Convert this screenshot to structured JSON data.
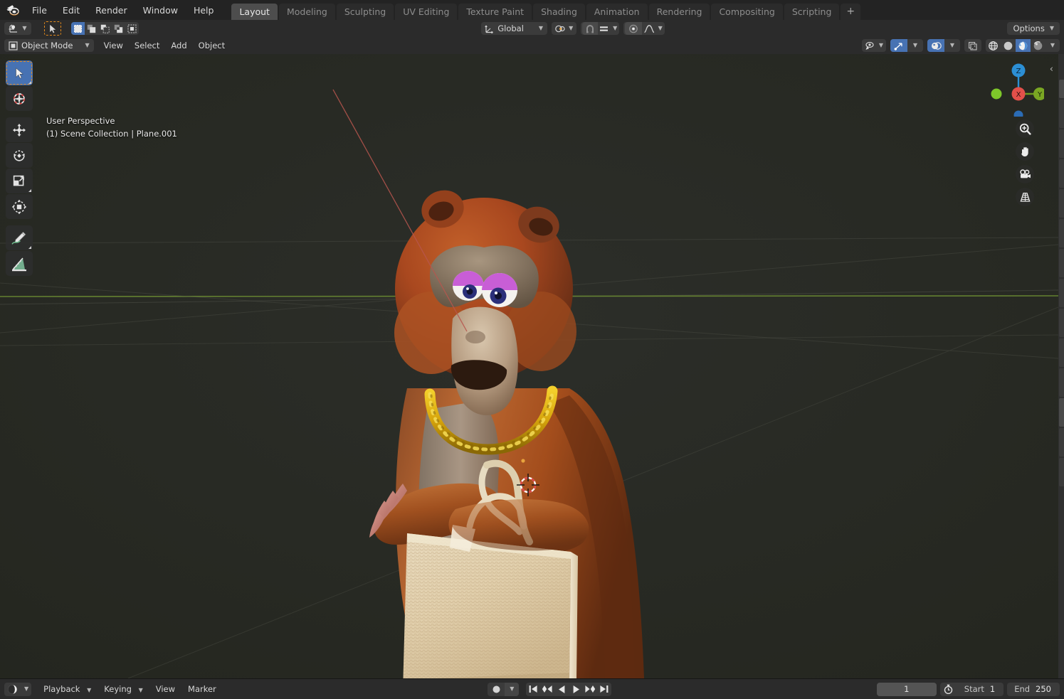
{
  "app": {
    "name": "Blender",
    "logo_icon": "blender-logo-icon"
  },
  "topbar": {
    "menus": [
      {
        "label": "File",
        "name": "menu-file"
      },
      {
        "label": "Edit",
        "name": "menu-edit"
      },
      {
        "label": "Render",
        "name": "menu-render"
      },
      {
        "label": "Window",
        "name": "menu-window"
      },
      {
        "label": "Help",
        "name": "menu-help"
      }
    ],
    "workspace_tabs": [
      {
        "label": "Layout",
        "active": true
      },
      {
        "label": "Modeling",
        "active": false
      },
      {
        "label": "Sculpting",
        "active": false
      },
      {
        "label": "UV Editing",
        "active": false
      },
      {
        "label": "Texture Paint",
        "active": false
      },
      {
        "label": "Shading",
        "active": false
      },
      {
        "label": "Animation",
        "active": false
      },
      {
        "label": "Rendering",
        "active": false
      },
      {
        "label": "Compositing",
        "active": false
      },
      {
        "label": "Scripting",
        "active": false
      }
    ],
    "add_workspace_label": "+"
  },
  "tool_header": {
    "editor_type_icon": "editor-type-3dview-icon",
    "active_tool_icon": "tweak-cursor-icon",
    "select_modes": [
      {
        "name": "select-set-mode",
        "active": true
      },
      {
        "name": "select-extend-mode",
        "active": false
      },
      {
        "name": "select-subtract-mode",
        "active": false
      },
      {
        "name": "select-invert-mode",
        "active": false
      },
      {
        "name": "select-intersect-mode",
        "active": false
      }
    ],
    "transform_orientation": {
      "label": "Global",
      "icon": "orientation-global-icon"
    },
    "pivot_point": {
      "icon": "pivot-median-point-icon"
    },
    "snap": {
      "magnet_icon": "magnet-icon",
      "snap_to_icon": "snap-increment-icon",
      "enabled": false
    },
    "proportional_editing": {
      "toggle_icon": "proportional-edit-icon",
      "falloff_icon": "falloff-smooth-icon",
      "enabled": false
    },
    "options_label": "Options"
  },
  "viewport_header": {
    "mode": {
      "label": "Object Mode",
      "icon": "object-mode-icon"
    },
    "menus": [
      {
        "label": "View",
        "name": "viewport-menu-view"
      },
      {
        "label": "Select",
        "name": "viewport-menu-select"
      },
      {
        "label": "Add",
        "name": "viewport-menu-add"
      },
      {
        "label": "Object",
        "name": "viewport-menu-object"
      }
    ],
    "right_controls": [
      {
        "name": "visibility-selector",
        "icon": "eye-cursor-icon",
        "active": false
      },
      {
        "name": "gizmo-toggle",
        "icon": "gizmo-icon",
        "active": true
      },
      {
        "name": "overlays-toggle",
        "icon": "overlays-icon",
        "active": true
      },
      {
        "name": "xray-toggle",
        "icon": "xray-icon",
        "active": false
      }
    ],
    "shading_modes": [
      {
        "name": "shading-wireframe",
        "icon": "wireframe-globe-icon",
        "active": false
      },
      {
        "name": "shading-solid",
        "icon": "solid-sphere-icon",
        "active": false
      },
      {
        "name": "shading-material-preview",
        "icon": "material-preview-icon",
        "active": true
      },
      {
        "name": "shading-rendered",
        "icon": "rendered-sphere-icon",
        "active": false
      }
    ]
  },
  "viewport": {
    "overlay_line_1": "User Perspective",
    "overlay_line_2": "(1) Scene Collection | Plane.001",
    "background_color": "#282a26",
    "grid_color": "#3a3c38",
    "y_axis_color": "#6a8a32",
    "left_toolbar": [
      {
        "name": "tool-tweak",
        "icon": "cursor-arrow-icon",
        "selected": true,
        "has_submenu": true
      },
      {
        "name": "tool-cursor",
        "icon": "3d-cursor-icon",
        "selected": false,
        "has_submenu": false
      },
      {
        "name": "tool-move",
        "icon": "move-arrows-icon",
        "selected": false,
        "has_submenu": false,
        "group_start": true
      },
      {
        "name": "tool-rotate",
        "icon": "rotate-icon",
        "selected": false,
        "has_submenu": false
      },
      {
        "name": "tool-scale",
        "icon": "scale-icon",
        "selected": false,
        "has_submenu": true
      },
      {
        "name": "tool-transform",
        "icon": "transform-icon",
        "selected": false,
        "has_submenu": false
      },
      {
        "name": "tool-annotate",
        "icon": "pencil-annotate-icon",
        "selected": false,
        "has_submenu": true,
        "group_start": true
      },
      {
        "name": "tool-measure",
        "icon": "ruler-measure-icon",
        "selected": false,
        "has_submenu": false
      }
    ],
    "nav_gizmo": {
      "axes": [
        {
          "label": "X",
          "color": "#e2504a",
          "name": "gizmo-axis-x"
        },
        {
          "label": "Y",
          "color": "#7aa723",
          "name": "gizmo-axis-y"
        },
        {
          "label": "Z",
          "color": "#2c8fd4",
          "name": "gizmo-axis-z"
        }
      ],
      "negative_axis_colors": [
        "#7ec82a",
        "#2b6cb5"
      ]
    },
    "nav_buttons": [
      {
        "name": "zoom-view-button",
        "icon": "magnifier-plus-icon"
      },
      {
        "name": "pan-view-button",
        "icon": "hand-icon"
      },
      {
        "name": "camera-view-button",
        "icon": "camera-icon"
      },
      {
        "name": "toggle-perspective-button",
        "icon": "perspective-grid-icon"
      }
    ],
    "sidebar_toggle_icon": "chevron-left-icon",
    "scene_objects": {
      "character": "bear character with gold necklace holding woven tote bag",
      "cursor_3d": "3d-cursor",
      "origin_point": "object-origin-dot"
    }
  },
  "timeline": {
    "editor_type_icon": "editor-type-timeline-icon",
    "menus": [
      {
        "label": "Playback",
        "name": "timeline-menu-playback",
        "dropdown": true
      },
      {
        "label": "Keying",
        "name": "timeline-menu-keying",
        "dropdown": true
      },
      {
        "label": "View",
        "name": "timeline-menu-view",
        "dropdown": false
      },
      {
        "label": "Marker",
        "name": "timeline-menu-marker",
        "dropdown": false
      }
    ],
    "auto_keying_icon": "record-dot-icon",
    "playback_buttons": [
      {
        "name": "jump-to-start-button",
        "icon": "jump-start-icon"
      },
      {
        "name": "jump-to-previous-keyframe-button",
        "icon": "prev-keyframe-icon"
      },
      {
        "name": "play-reverse-button",
        "icon": "play-reverse-icon"
      },
      {
        "name": "play-button",
        "icon": "play-icon"
      },
      {
        "name": "jump-to-next-keyframe-button",
        "icon": "next-keyframe-icon"
      },
      {
        "name": "jump-to-end-button",
        "icon": "jump-end-icon"
      }
    ],
    "current_frame": "1",
    "stopwatch_icon": "stopwatch-icon",
    "start_label": "Start",
    "start_value": "1",
    "end_label": "End",
    "end_value": "250"
  }
}
